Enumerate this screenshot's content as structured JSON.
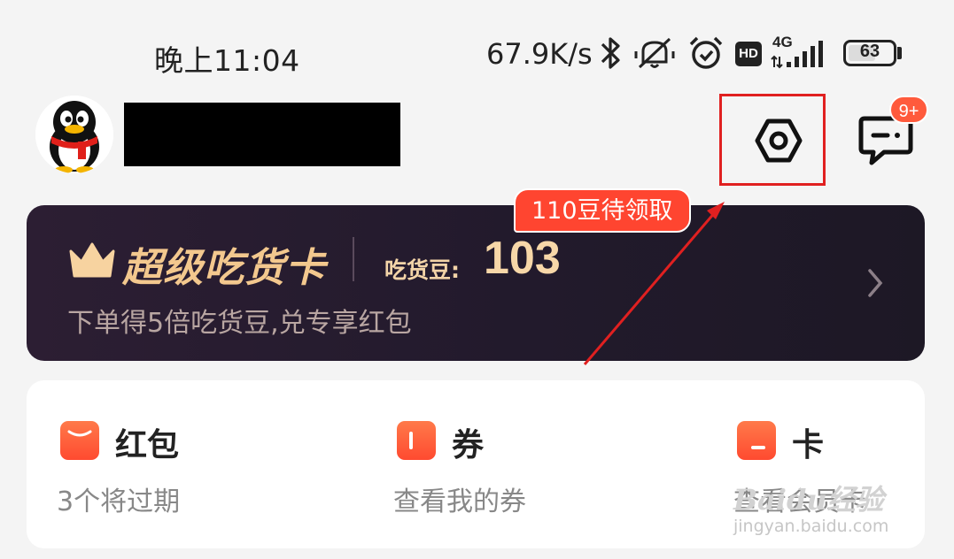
{
  "status_bar": {
    "time": "晚上11:04",
    "network_speed": "67.9K/s",
    "network_type": "4G",
    "hd_label": "HD",
    "battery": "63",
    "battery_level": 0.63,
    "icons": [
      "bluetooth-icon",
      "mute-icon",
      "alarm-icon",
      "hd-icon",
      "signal-icon",
      "battery-icon"
    ]
  },
  "header": {
    "avatar_icon": "qq-penguin-avatar",
    "username": "",
    "message_badge": "9+"
  },
  "vip_card": {
    "title": "超级吃货卡",
    "beans_label": "吃货豆:",
    "beans_value": "103",
    "subtitle": "下单得5倍吃货豆,兑专享红包",
    "pending_badge": "110豆待领取"
  },
  "assets": [
    {
      "title": "红包",
      "subtitle": "3个将过期",
      "icon": "red-packet-icon"
    },
    {
      "title": "券",
      "subtitle": "查看我的券",
      "icon": "coupon-icon"
    },
    {
      "title": "卡",
      "subtitle": "查看会员卡",
      "icon": "card-icon"
    }
  ],
  "watermark": {
    "logo": "Baidu经验",
    "url": "jingyan.baidu.com"
  },
  "colors": {
    "accent": "#ff4a30",
    "vip_gold": "#f3c88e",
    "vip_bg": "#261c2e",
    "annotation": "#e02020"
  }
}
